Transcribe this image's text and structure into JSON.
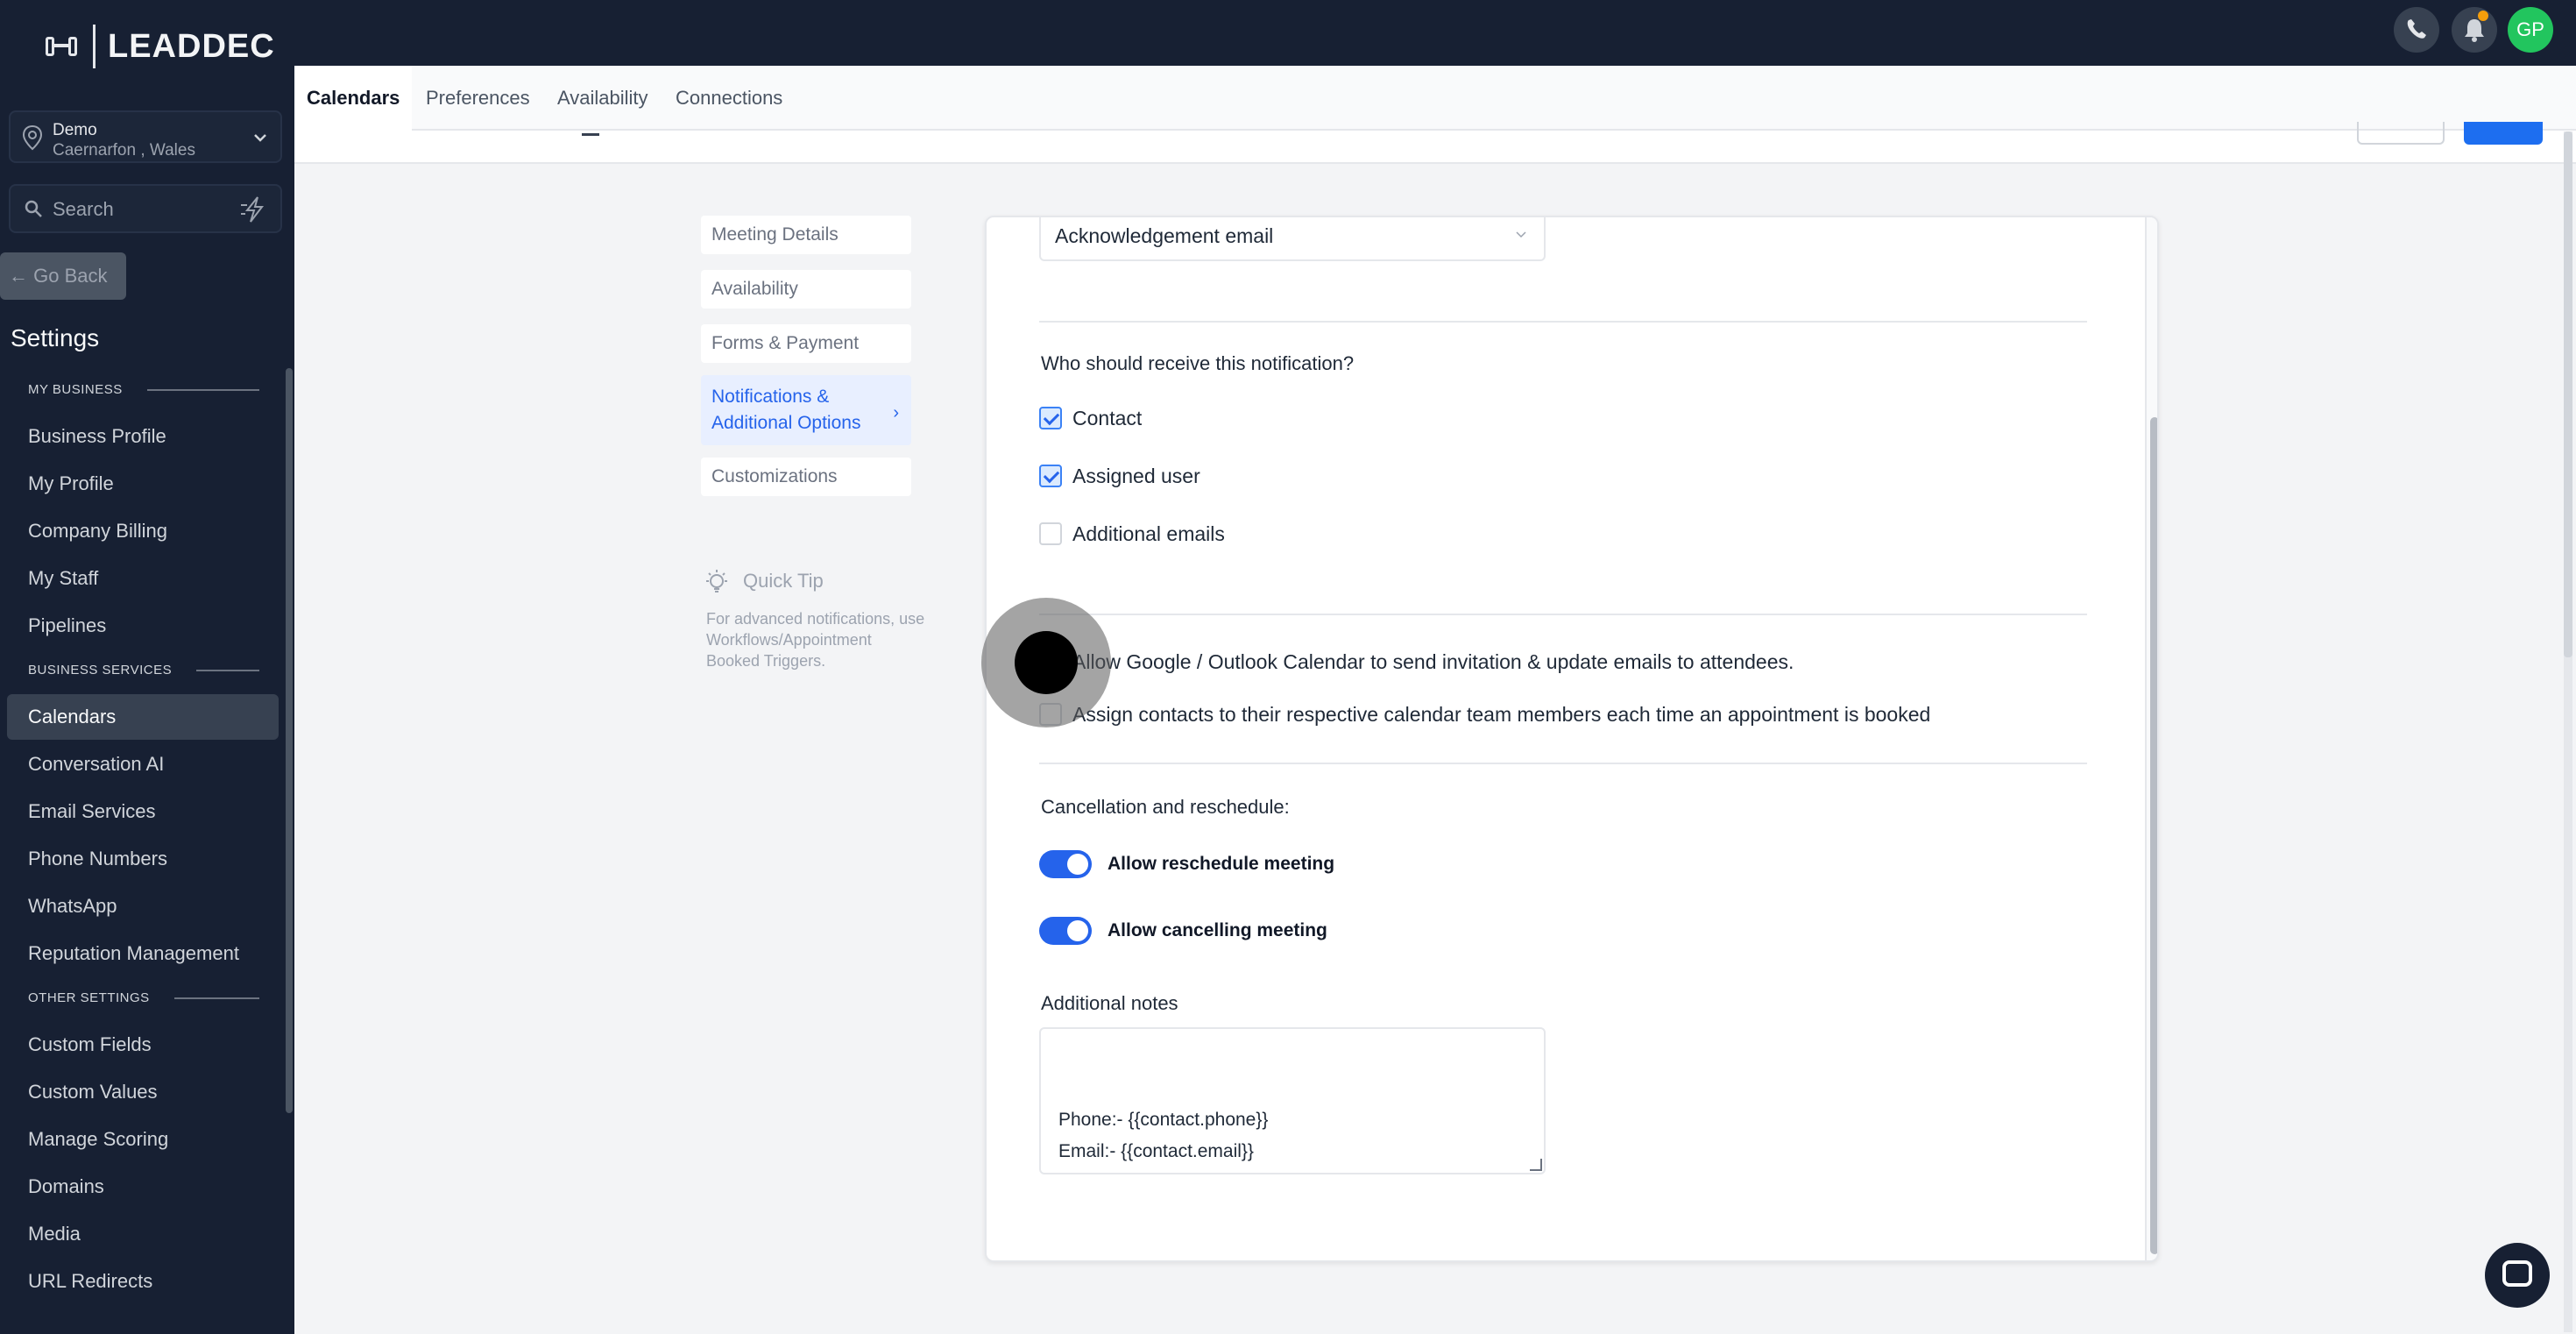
{
  "brand": {
    "name": "LEADDEC"
  },
  "location": {
    "name": "Demo",
    "sub": "Caernarfon , Wales"
  },
  "search": {
    "placeholder": "Search"
  },
  "go_back": "← Go Back",
  "settings_title": "Settings",
  "sidebar": {
    "sections": [
      {
        "label": "MY BUSINESS",
        "items": [
          "Business Profile",
          "My Profile",
          "Company Billing",
          "My Staff",
          "Pipelines"
        ]
      },
      {
        "label": "BUSINESS SERVICES",
        "items": [
          "Calendars",
          "Conversation AI",
          "Email Services",
          "Phone Numbers",
          "WhatsApp",
          "Reputation Management"
        ]
      },
      {
        "label": "OTHER SETTINGS",
        "items": [
          "Custom Fields",
          "Custom Values",
          "Manage Scoring",
          "Domains",
          "Media",
          "URL Redirects"
        ]
      }
    ],
    "active": "Calendars"
  },
  "topbar": {
    "avatar_initials": "GP"
  },
  "tabs": [
    "Calendars",
    "Preferences",
    "Availability",
    "Connections"
  ],
  "subnav": {
    "items": [
      "Meeting Details",
      "Availability",
      "Forms & Payment",
      "Notifications & Additional Options",
      "Customizations"
    ],
    "active_line1": "Notifications &",
    "active_line2": "Additional Options"
  },
  "quick_tip": {
    "title": "Quick Tip",
    "text": "For advanced notifications, use Workflows/Appointment Booked Triggers."
  },
  "form": {
    "template_select": "Acknowledgement email",
    "recipients_question": "Who should receive this notification?",
    "recipients": [
      {
        "label": "Contact",
        "checked": true
      },
      {
        "label": "Assigned user",
        "checked": true
      },
      {
        "label": "Additional emails",
        "checked": false
      }
    ],
    "options": [
      {
        "label": "Allow Google / Outlook Calendar to send invitation & update emails to attendees.",
        "checked": false
      },
      {
        "label": "Assign contacts to their respective calendar team members each time an appointment is booked",
        "checked": false
      }
    ],
    "cancellation_title": "Cancellation and reschedule:",
    "toggles": [
      {
        "label": "Allow reschedule meeting",
        "on": true
      },
      {
        "label": "Allow cancelling meeting",
        "on": true
      }
    ],
    "notes_title": "Additional notes",
    "notes_text": "Phone:- {{contact.phone}}\nEmail:- {{contact.email}}\n\nNeed to make a change to this event?\nReschedule:"
  },
  "colors": {
    "accent": "#2563eb",
    "sidebar_bg": "#172033",
    "avatar_bg": "#22c55e"
  }
}
